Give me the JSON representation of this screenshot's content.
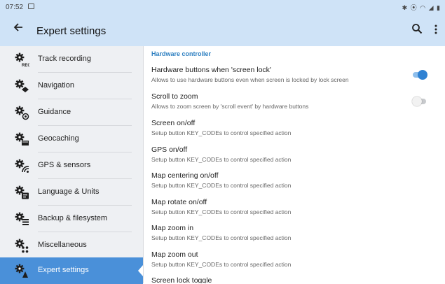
{
  "status_bar": {
    "time": "07:52",
    "left_icons": [
      "gallery-icon"
    ],
    "right_icons": [
      "bluetooth-icon",
      "location-icon",
      "wifi-icon",
      "signal-icon",
      "battery-icon"
    ]
  },
  "app_bar": {
    "title": "Expert settings",
    "icons": [
      "back-arrow-icon",
      "search-icon",
      "more-vert-icon"
    ]
  },
  "colors": {
    "bar_bg": "#cfe3f7",
    "accent": "#2d7fc1",
    "active_item": "#4a90d9",
    "toggle_on": "#2f82d3",
    "sidebar_bg": "#eef0f3"
  },
  "sidebar": {
    "items": [
      {
        "label": "Track recording",
        "icon": "track-recording-icon"
      },
      {
        "label": "Navigation",
        "icon": "navigation-icon"
      },
      {
        "label": "Guidance",
        "icon": "guidance-icon"
      },
      {
        "label": "Geocaching",
        "icon": "geocaching-icon"
      },
      {
        "label": "GPS & sensors",
        "icon": "gps-sensors-icon"
      },
      {
        "label": "Language & Units",
        "icon": "language-units-icon"
      },
      {
        "label": "Backup & filesystem",
        "icon": "backup-filesystem-icon"
      },
      {
        "label": "Miscellaneous",
        "icon": "miscellaneous-icon"
      },
      {
        "label": "Expert settings",
        "icon": "expert-settings-icon",
        "selected": true
      }
    ]
  },
  "main": {
    "section_title": "Hardware controller",
    "settings": [
      {
        "title": "Hardware buttons when 'screen lock'",
        "subtitle": "Allows to use hardware buttons even when screen is locked by lock screen",
        "toggle": true
      },
      {
        "title": "Scroll to zoom",
        "subtitle": "Allows to zoom screen by 'scroll event' by hardware buttons",
        "toggle": false
      },
      {
        "title": "Screen on/off",
        "subtitle": "Setup button KEY_CODEs to control specified action"
      },
      {
        "title": "GPS on/off",
        "subtitle": "Setup button KEY_CODEs to control specified action"
      },
      {
        "title": "Map centering on/off",
        "subtitle": "Setup button KEY_CODEs to control specified action"
      },
      {
        "title": "Map rotate on/off",
        "subtitle": "Setup button KEY_CODEs to control specified action"
      },
      {
        "title": "Map zoom in",
        "subtitle": "Setup button KEY_CODEs to control specified action"
      },
      {
        "title": "Map zoom out",
        "subtitle": "Setup button KEY_CODEs to control specified action"
      },
      {
        "title": "Screen lock toggle",
        "subtitle": ""
      }
    ]
  }
}
